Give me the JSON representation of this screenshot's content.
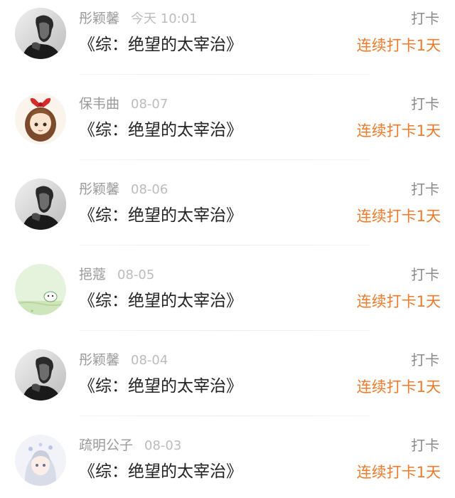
{
  "colors": {
    "username": "#9a9a9a",
    "time": "#bcbcbc",
    "title": "#222222",
    "streak": "#f07a2c",
    "action": "#8a8a8a"
  },
  "feed": {
    "items": [
      {
        "user": "彤颖馨",
        "time": "今天 10:01",
        "title": "《综：绝望的太宰治》",
        "action": "打卡",
        "streak": "连续打卡1天",
        "avatar": "bw-man-portrait"
      },
      {
        "user": "保韦曲",
        "time": "08-07",
        "title": "《综：绝望的太宰治》",
        "action": "打卡",
        "streak": "连续打卡1天",
        "avatar": "anime-girl-red-bow"
      },
      {
        "user": "彤颖馨",
        "time": "08-06",
        "title": "《综：绝望的太宰治》",
        "action": "打卡",
        "streak": "连续打卡1天",
        "avatar": "bw-man-portrait"
      },
      {
        "user": "挹蔻",
        "time": "08-05",
        "title": "《综：绝望的太宰治》",
        "action": "打卡",
        "streak": "连续打卡1天",
        "avatar": "green-cartoon"
      },
      {
        "user": "彤颖馨",
        "time": "08-04",
        "title": "《综：绝望的太宰治》",
        "action": "打卡",
        "streak": "连续打卡1天",
        "avatar": "bw-man-portrait"
      },
      {
        "user": "疏明公子",
        "time": "08-03",
        "title": "《综：绝望的太宰治》",
        "action": "打卡",
        "streak": "连续打卡1天",
        "avatar": "anime-silver-hair"
      }
    ]
  }
}
